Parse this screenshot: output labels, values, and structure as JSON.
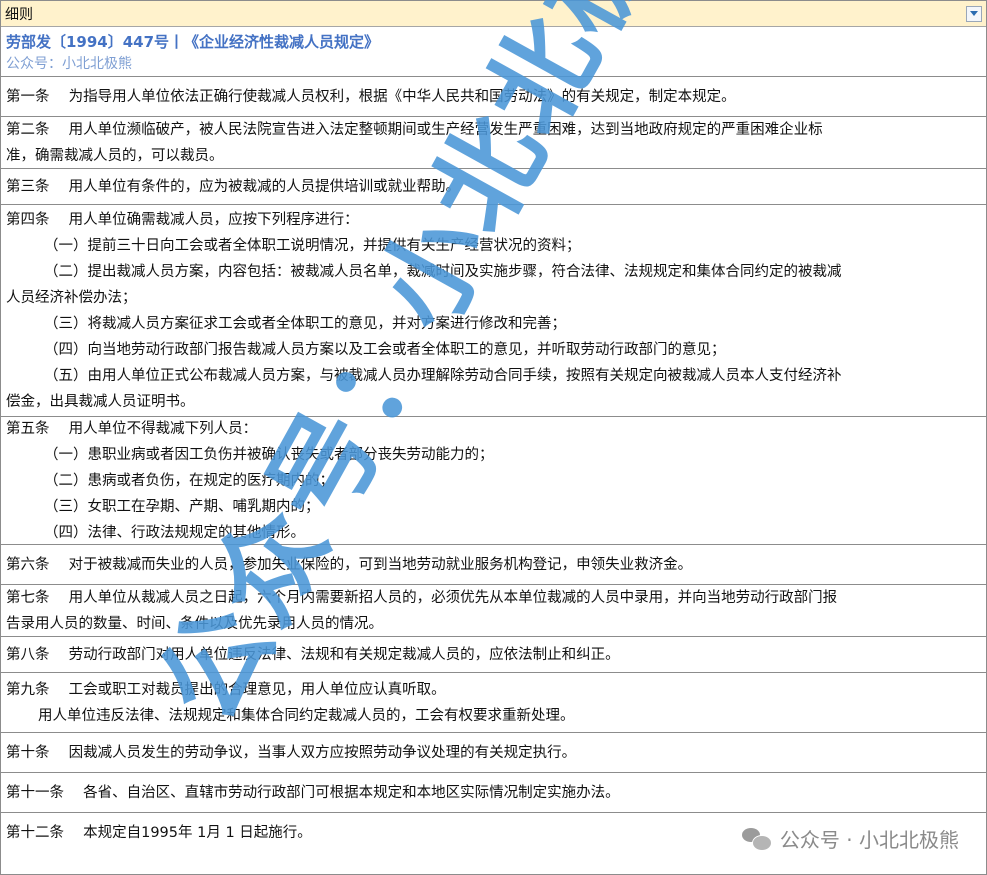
{
  "header": {
    "cell_label": "细则"
  },
  "doc": {
    "title": "劳部发〔1994〕447号丨《企业经济性裁减人员规定》",
    "subtitle": "公众号：小北北极熊"
  },
  "articles": [
    {
      "lines": [
        "第一条　 为指导用人单位依法正确行使裁减人员权利，根据《中华人民共和国劳动法》的有关规定，制定本规定。"
      ]
    },
    {
      "lines": [
        "第二条　 用人单位濒临破产，被人民法院宣告进入法定整顿期间或生产经营发生严重困难，达到当地政府规定的严重困难企业标",
        "准，确需裁减人员的，可以裁员。"
      ]
    },
    {
      "lines": [
        "第三条　 用人单位有条件的，应为被裁减的人员提供培训或就业帮助。"
      ]
    },
    {
      "lines": [
        "第四条　 用人单位确需裁减人员，应按下列程序进行："
      ],
      "items": [
        [
          "（一）提前三十日向工会或者全体职工说明情况，并提供有关生产经营状况的资料；"
        ],
        [
          "（二）提出裁减人员方案，内容包括：被裁减人员名单，裁减时间及实施步骤，符合法律、法规规定和集体合同约定的被裁减",
          "人员经济补偿办法；"
        ],
        [
          "（三）将裁减人员方案征求工会或者全体职工的意见，并对方案进行修改和完善；"
        ],
        [
          "（四）向当地劳动行政部门报告裁减人员方案以及工会或者全体职工的意见，并听取劳动行政部门的意见；"
        ],
        [
          "（五）由用人单位正式公布裁减人员方案，与被裁减人员办理解除劳动合同手续，按照有关规定向被裁减人员本人支付经济补",
          "偿金，出具裁减人员证明书。"
        ]
      ]
    },
    {
      "lines": [
        "第五条　 用人单位不得裁减下列人员："
      ],
      "items": [
        [
          "（一）患职业病或者因工负伤并被确认丧失或者部分丧失劳动能力的；"
        ],
        [
          "（二）患病或者负伤，在规定的医疗期内的；"
        ],
        [
          "（三）女职工在孕期、产期、哺乳期内的；"
        ],
        [
          "（四）法律、行政法规规定的其他情形。"
        ]
      ]
    },
    {
      "lines": [
        "第六条　 对于被裁减而失业的人员，参加失业保险的，可到当地劳动就业服务机构登记，申领失业救济金。"
      ]
    },
    {
      "lines": [
        "第七条　 用人单位从裁减人员之日起，六个月内需要新招人员的，必须优先从本单位裁减的人员中录用，并向当地劳动行政部门报",
        "告录用人员的数量、时间、条件以及优先录用人员的情况。"
      ]
    },
    {
      "lines": [
        "第八条　 劳动行政部门对用人单位违反法律、法规和有关规定裁减人员的，应依法制止和纠正。"
      ]
    },
    {
      "lines": [
        "第九条　 工会或职工对裁员提出的合理意见，用人单位应认真听取。"
      ],
      "sub": [
        "用人单位违反法律、法规规定和集体合同约定裁减人员的，工会有权要求重新处理。"
      ]
    },
    {
      "lines": [
        "第十条　 因裁减人员发生的劳动争议，当事人双方应按照劳动争议处理的有关规定执行。"
      ]
    },
    {
      "lines": [
        "第十一条　 各省、自治区、直辖市劳动行政部门可根据本规定和本地区实际情况制定实施办法。"
      ]
    },
    {
      "lines": [
        "第十二条　 本规定自1995年 1月 1 日起施行。"
      ]
    }
  ],
  "watermark": {
    "text": "公众号：小北北极熊"
  },
  "footer_watermark": {
    "text": "公众号 · 小北北极熊",
    "icon": "wechat-icon"
  }
}
